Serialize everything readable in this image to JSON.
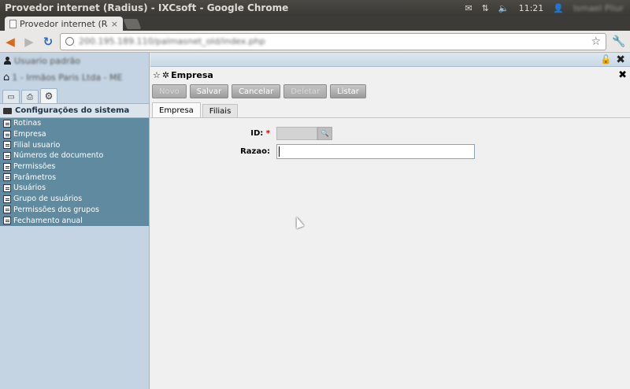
{
  "os": {
    "window_title": "Provedor internet (Radius) - IXCsoft - Google Chrome",
    "clock": "11:21",
    "user": "Ismael Pliur"
  },
  "browser": {
    "tab_title": "Provedor internet (Radius",
    "tab_close": "×",
    "url": "200.195.189.110/palmasnet_old/index.php"
  },
  "sidebar": {
    "user_name": "Usuario padrão",
    "company": "1 - Irmãos Paris Ltda - ME",
    "section_title": "Configurações do sistema",
    "items": [
      "Rotinas",
      "Empresa",
      "Filial usuario",
      "Números de documento",
      "Permissões",
      "Parâmetros",
      "Usuários",
      "Grupo de usuários",
      "Permissões dos grupos",
      "Fechamento anual"
    ]
  },
  "window": {
    "title": "Empresa",
    "buttons": {
      "novo": "Novo",
      "salvar": "Salvar",
      "cancelar": "Cancelar",
      "deletar": "Deletar",
      "listar": "Listar"
    },
    "tabs": [
      "Empresa",
      "Filiais"
    ],
    "fields": {
      "id_label": "ID:",
      "id_required": "*",
      "razao_label": "Razao:"
    }
  }
}
